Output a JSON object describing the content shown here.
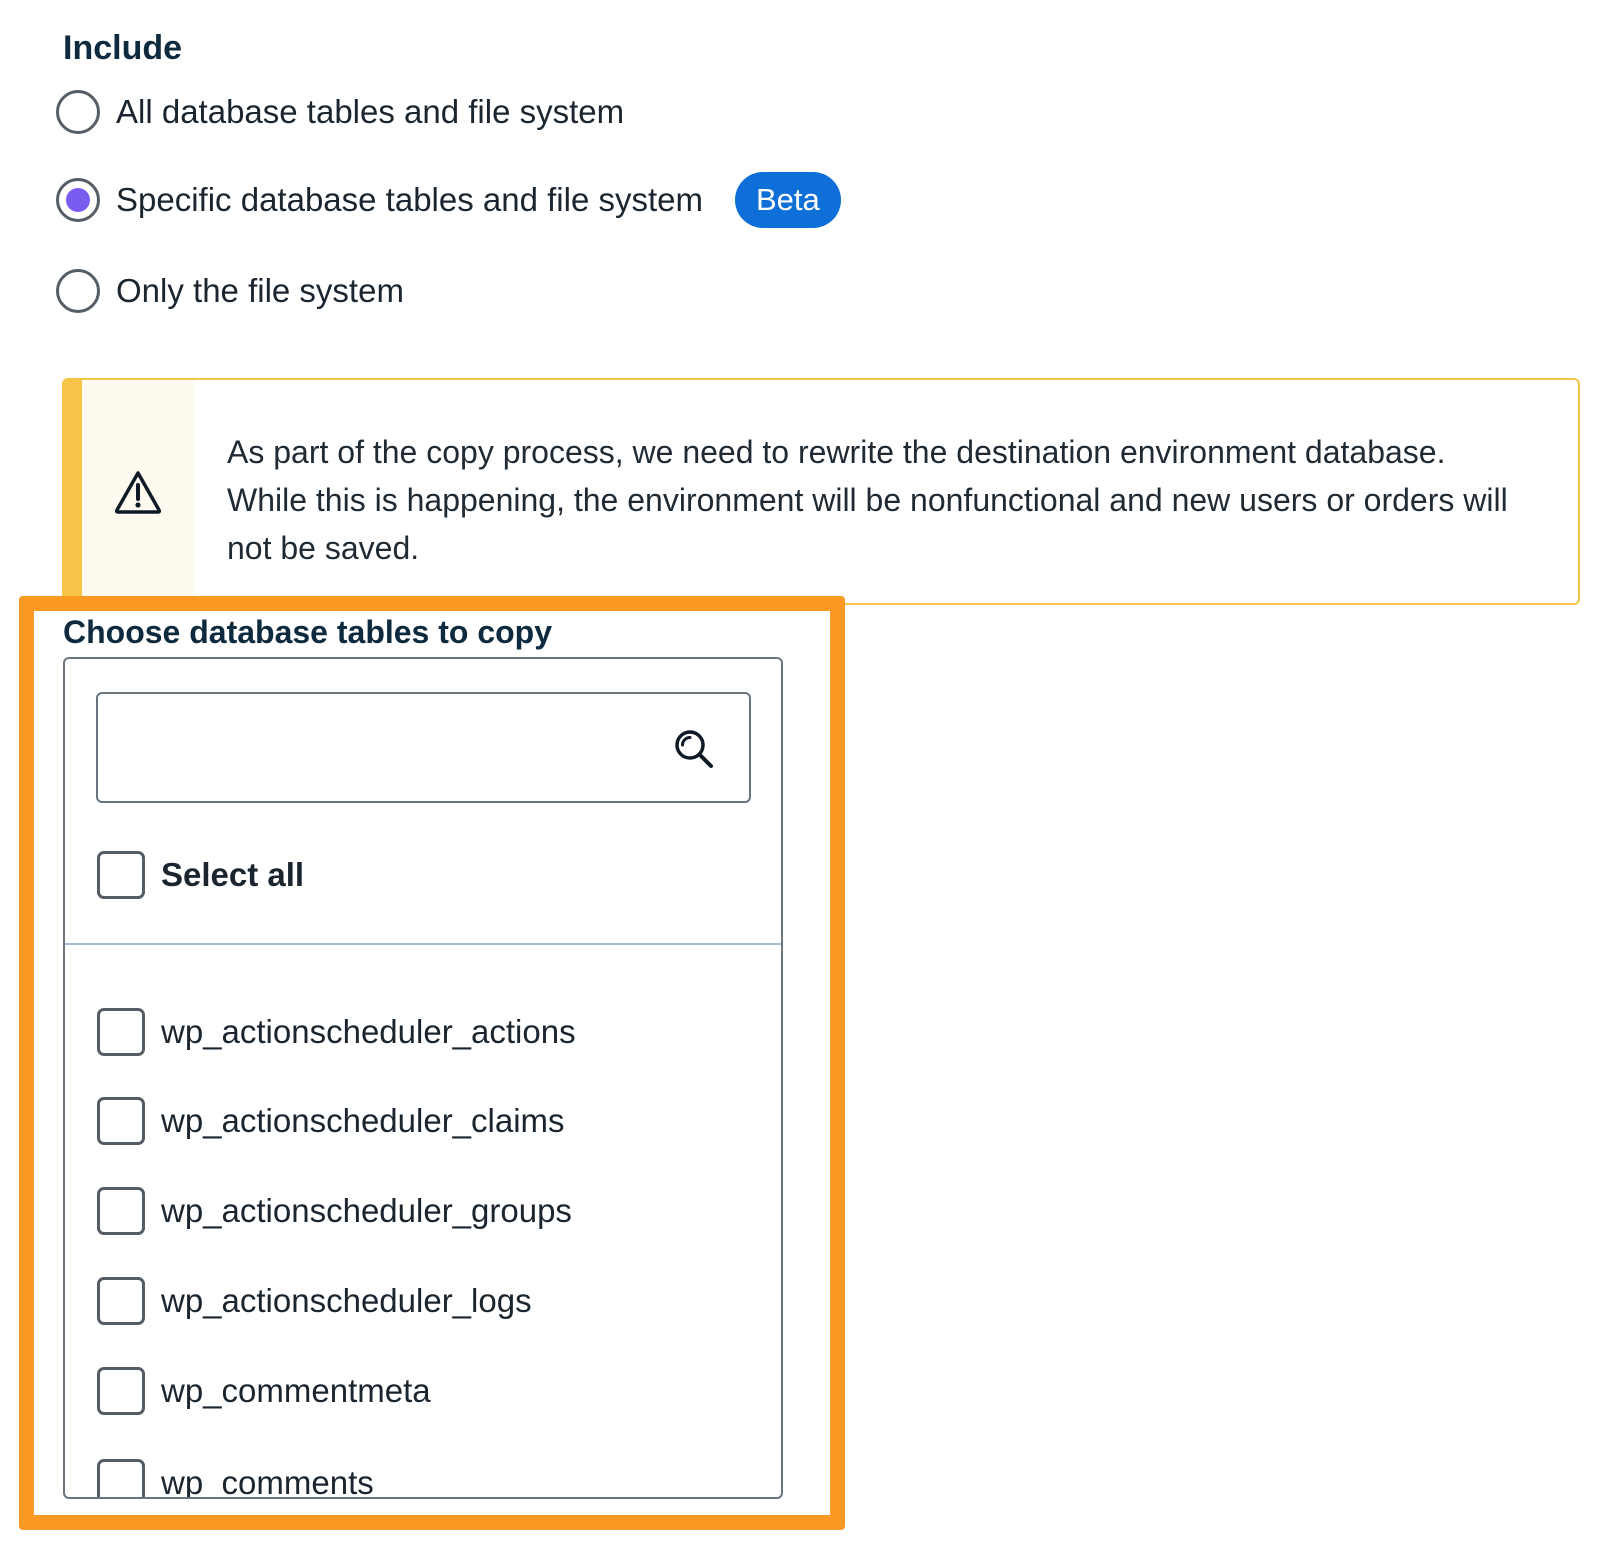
{
  "include": {
    "title": "Include",
    "options": [
      {
        "label": "All database tables and file system",
        "selected": false
      },
      {
        "label": "Specific database tables and file system",
        "selected": true,
        "badge": "Beta"
      },
      {
        "label": "Only the file system",
        "selected": false
      }
    ]
  },
  "notice": {
    "icon": "warning-icon",
    "text": "As part of the copy process, we need to rewrite the destination environment database. While this is happening, the environment will be nonfunctional and new users or orders will not be saved."
  },
  "tables": {
    "title": "Choose database tables to copy",
    "search": {
      "value": "",
      "placeholder": ""
    },
    "select_all_label": "Select all",
    "items": [
      "wp_actionscheduler_actions",
      "wp_actionscheduler_claims",
      "wp_actionscheduler_groups",
      "wp_actionscheduler_logs",
      "wp_commentmeta",
      "wp_comments"
    ]
  },
  "colors": {
    "accent_radio": "#7b5cf0",
    "badge_blue": "#0f6fd9",
    "warning_yellow": "#f7c54a",
    "highlight_orange": "#fb9a23"
  }
}
